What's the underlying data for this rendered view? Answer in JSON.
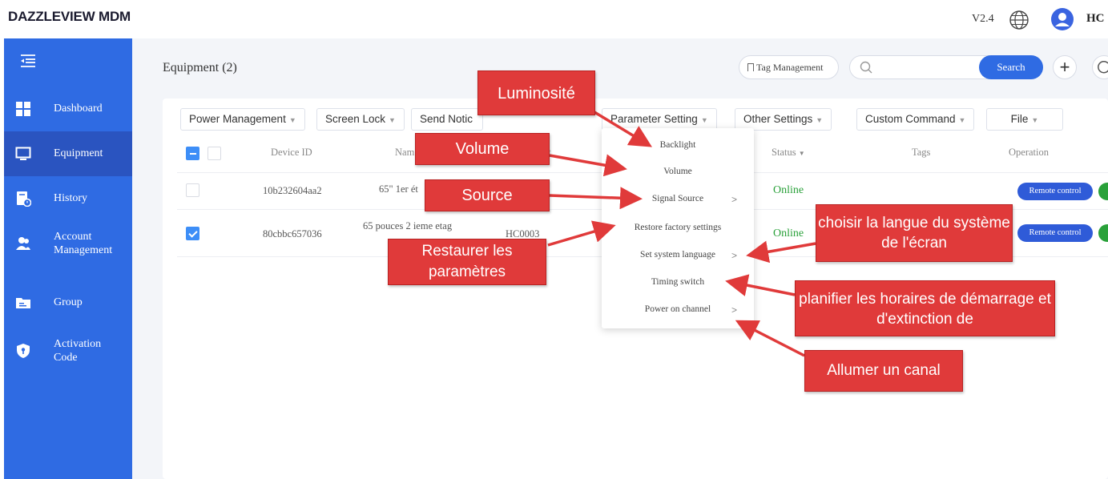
{
  "app": {
    "logo": "DAZZLEVIEW MDM",
    "version": "V2.4",
    "user": "HC"
  },
  "sidebar": {
    "items": [
      {
        "label": "Dashboard",
        "icon": "dashboard-icon"
      },
      {
        "label": "Equipment",
        "icon": "monitor-icon",
        "active": true
      },
      {
        "label": "History",
        "icon": "history-icon"
      },
      {
        "label": "Account Management",
        "icon": "users-icon"
      },
      {
        "label": "Group",
        "icon": "group-icon"
      },
      {
        "label": "Activation Code",
        "icon": "shield-icon"
      }
    ]
  },
  "header": {
    "title": "Equipment (2)",
    "tag_management": "Tag Management",
    "search_placeholder": "",
    "search_label": "Search"
  },
  "toolbar": {
    "buttons": [
      "Power Management",
      "Screen Lock",
      "Send Notic",
      "Parameter Setting",
      "Other Settings",
      "Custom Command",
      "File"
    ]
  },
  "table": {
    "headers": {
      "device_id": "Device ID",
      "name": "Nam",
      "account": "nt",
      "status": "Status",
      "tags": "Tags",
      "operation": "Operation"
    },
    "rows": [
      {
        "device_id": "10b232604aa2",
        "name": "65\" 1er ét",
        "account": "",
        "status": "Online",
        "action": "Remote control",
        "checked": false
      },
      {
        "device_id": "80cbbc657036",
        "name": "65 pouces 2 ieme etag",
        "account": "HC0003",
        "status": "Online",
        "action": "Remote control",
        "checked": true
      }
    ]
  },
  "dropdown": {
    "items": [
      {
        "label": "Backlight",
        "submenu": false
      },
      {
        "label": "Volume",
        "submenu": false
      },
      {
        "label": "Signal Source",
        "submenu": true
      },
      {
        "label": "Restore factory settings",
        "submenu": false
      },
      {
        "label": "Set system language",
        "submenu": true
      },
      {
        "label": "Timing switch",
        "submenu": false
      },
      {
        "label": "Power on channel",
        "submenu": true
      }
    ]
  },
  "annotations": {
    "luminosite": "Luminosité",
    "volume": "Volume",
    "source": "Source",
    "restaurer": "Restaurer les paramètres",
    "langue": "choisir la langue du système de l'écran",
    "planifier": "planifier les horaires de démarrage et d'extinction de",
    "canal": "Allumer un canal"
  },
  "colors": {
    "sidebar": "#2f6be3",
    "sidebar_active": "#2a54c0",
    "accent": "#2f6be3",
    "online": "#2aa13a",
    "annotation": "#e03a3a"
  }
}
